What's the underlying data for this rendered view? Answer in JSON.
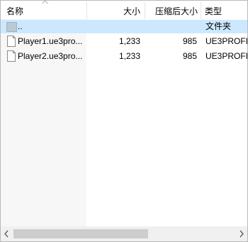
{
  "header": {
    "columns": [
      {
        "label": "名称"
      },
      {
        "label": "大小"
      },
      {
        "label": "压缩后大小"
      },
      {
        "label": "类型"
      }
    ]
  },
  "rows": [
    {
      "name": "..",
      "size": "",
      "compressed": "",
      "type": "文件夹",
      "icon": "folder-icon",
      "selected": true
    },
    {
      "name": "Player1.ue3pro...",
      "size": "1,233",
      "compressed": "985",
      "type": "UE3PROFI",
      "icon": "file-icon"
    },
    {
      "name": "Player2.ue3pro...",
      "size": "1,233",
      "compressed": "985",
      "type": "UE3PROFI",
      "icon": "file-icon"
    }
  ],
  "horizontal_scrollbar": {
    "left_arrow_icon": "chevron-left-icon",
    "right_arrow_icon": "chevron-right-icon"
  },
  "colors": {
    "selection": "#cce8ff",
    "name_column_shade": "#f7f7f7",
    "header_separator": "#e5e5e5",
    "scroll_track": "#f0f0f0",
    "scroll_thumb": "#cdcdcd",
    "border": "#b9b9b9"
  }
}
